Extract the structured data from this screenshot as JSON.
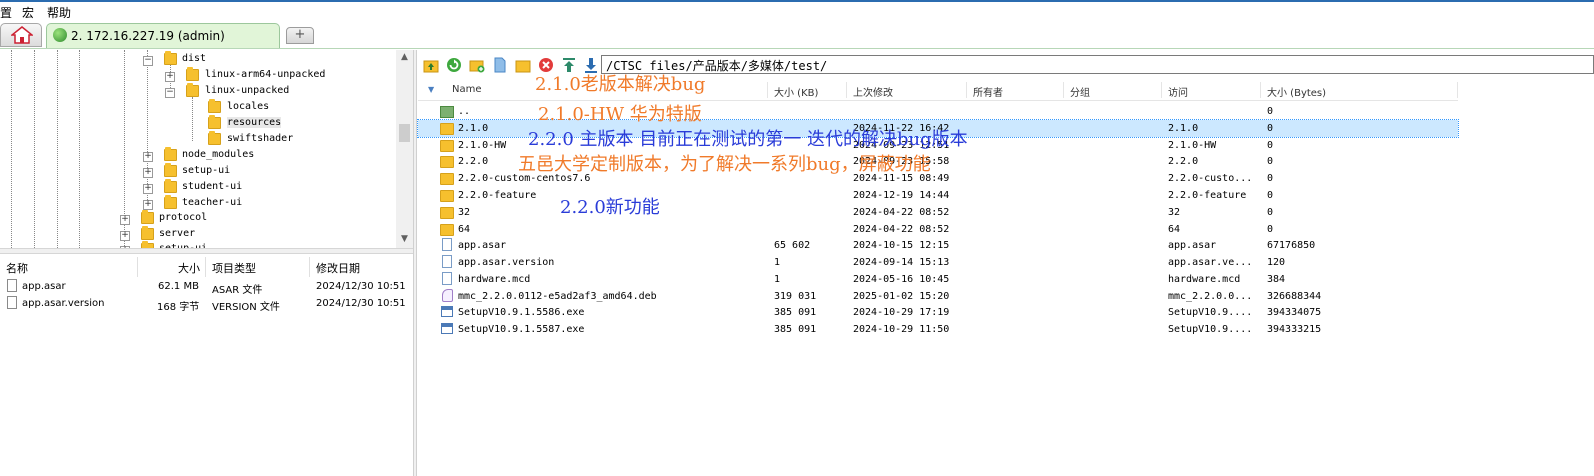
{
  "menu": {
    "items": [
      "置",
      "宏",
      "帮助"
    ]
  },
  "tabs": {
    "home_label": "",
    "session_label": "2. 172.16.227.19 (admin)",
    "new_tab_label": "+"
  },
  "tree": {
    "nodes": [
      {
        "label": "dist"
      },
      {
        "label": "linux-arm64-unpacked"
      },
      {
        "label": "linux-unpacked"
      },
      {
        "label": "locales"
      },
      {
        "label": "resources"
      },
      {
        "label": "swiftshader"
      },
      {
        "label": "node_modules"
      },
      {
        "label": "setup-ui"
      },
      {
        "label": "student-ui"
      },
      {
        "label": "teacher-ui"
      },
      {
        "label": "protocol"
      },
      {
        "label": "server"
      },
      {
        "label": "setup-ui"
      }
    ],
    "expand_minus": "−",
    "expand_plus": "+"
  },
  "local_list": {
    "headers": {
      "name": "名称",
      "size": "大小",
      "type": "项目类型",
      "modified": "修改日期"
    },
    "rows": [
      {
        "name": "app.asar",
        "size": "62.1 MB",
        "type": "ASAR 文件",
        "modified": "2024/12/30 10:51"
      },
      {
        "name": "app.asar.version",
        "size": "168 字节",
        "type": "VERSION 文件",
        "modified": "2024/12/30 10:51"
      }
    ]
  },
  "remote": {
    "path": "/CTSC files/产品版本/多媒体/test/",
    "toolbar_icons": [
      "parent-folder-icon",
      "refresh-icon",
      "new-folder-icon",
      "new-file-icon",
      "open-folder-icon",
      "delete-icon",
      "upload-icon",
      "download-icon"
    ],
    "headers": {
      "name": "Name",
      "size": "大小 (KB)",
      "modified": "上次修改",
      "owner": "所有者",
      "group": "分组",
      "access": "访问",
      "bytes": "大小 (Bytes)"
    },
    "rows": [
      {
        "kind": "up",
        "name": "..",
        "size": "",
        "modified": "",
        "access": "",
        "bytes": "0"
      },
      {
        "kind": "folder",
        "name": "2.1.0",
        "size": "",
        "modified": "2024-11-22 16:42",
        "access": "2.1.0",
        "bytes": "0",
        "selected": true
      },
      {
        "kind": "folder",
        "name": "2.1.0-HW",
        "size": "",
        "modified": "2024-09-23 12:51",
        "access": "2.1.0-HW",
        "bytes": "0"
      },
      {
        "kind": "folder",
        "name": "2.2.0",
        "size": "",
        "modified": "2024-09-23 15:58",
        "access": "2.2.0",
        "bytes": "0"
      },
      {
        "kind": "folder",
        "name": "2.2.0-custom-centos7.6",
        "size": "",
        "modified": "2024-11-15 08:49",
        "access": "2.2.0-custo...",
        "bytes": "0"
      },
      {
        "kind": "folder",
        "name": "2.2.0-feature",
        "size": "",
        "modified": "2024-12-19 14:44",
        "access": "2.2.0-feature",
        "bytes": "0"
      },
      {
        "kind": "folder",
        "name": "32",
        "size": "",
        "modified": "2024-04-22 08:52",
        "access": "32",
        "bytes": "0"
      },
      {
        "kind": "folder",
        "name": "64",
        "size": "",
        "modified": "2024-04-22 08:52",
        "access": "64",
        "bytes": "0"
      },
      {
        "kind": "file",
        "name": "app.asar",
        "size": "65 602",
        "modified": "2024-10-15 12:15",
        "access": "app.asar",
        "bytes": "67176850"
      },
      {
        "kind": "file",
        "name": "app.asar.version",
        "size": "1",
        "modified": "2024-09-14 15:13",
        "access": "app.asar.ve...",
        "bytes": "120"
      },
      {
        "kind": "file",
        "name": "hardware.mcd",
        "size": "1",
        "modified": "2024-05-16 10:45",
        "access": "hardware.mcd",
        "bytes": "384"
      },
      {
        "kind": "deb",
        "name": "mmc_2.2.0.0112-e5ad2af3_amd64.deb",
        "size": "319 031",
        "modified": "2025-01-02 15:20",
        "access": "mmc_2.2.0.0...",
        "bytes": "326688344"
      },
      {
        "kind": "exe",
        "name": "SetupV10.9.1.5586.exe",
        "size": "385 091",
        "modified": "2024-10-29 17:19",
        "access": "SetupV10.9....",
        "bytes": "394334075"
      },
      {
        "kind": "exe",
        "name": "SetupV10.9.1.5587.exe",
        "size": "385 091",
        "modified": "2024-10-29 11:50",
        "access": "SetupV10.9....",
        "bytes": "394333215"
      }
    ]
  },
  "annotations": [
    {
      "text": "2.1.0老版本解决bug",
      "color": "#f07a2a"
    },
    {
      "text": "2.1.0-HW 华为特版",
      "color": "#f07a2a"
    },
    {
      "text": "2.2.0 主版本 目前正在测试的第一 迭代的解决bug版本",
      "color": "#2a3cd8"
    },
    {
      "text": "五邑大学定制版本，为了解决一系列bug，屏蔽功能",
      "color": "#f07a2a"
    },
    {
      "text": "2.2.0新功能",
      "color": "#2a3cd8"
    }
  ],
  "colors": {
    "accent": "#2b6cb0",
    "selection": "#cce8ff",
    "folder": "#f6c02e",
    "tab_green": "#e1f5d8"
  }
}
